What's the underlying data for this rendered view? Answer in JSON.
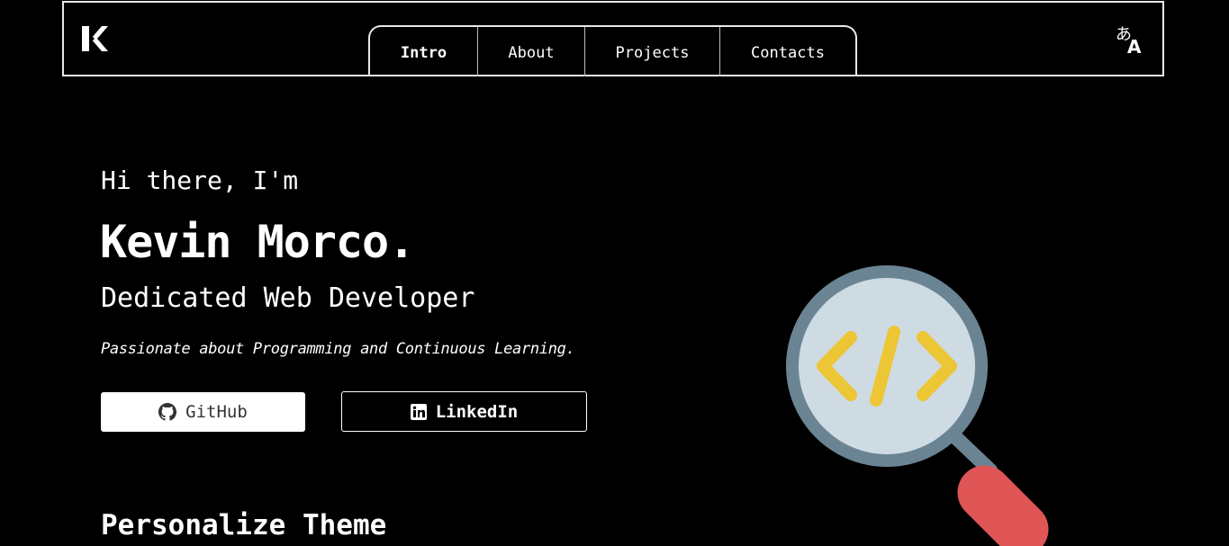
{
  "header": {
    "logo_alt": "K",
    "nav": [
      {
        "label": "Intro",
        "active": true
      },
      {
        "label": "About",
        "active": false
      },
      {
        "label": "Projects",
        "active": false
      },
      {
        "label": "Contacts",
        "active": false
      }
    ],
    "language_icon": "translate-icon"
  },
  "hero": {
    "greeting": "Hi there, I'm",
    "name": "Kevin Morco.",
    "role": "Dedicated Web Developer",
    "tagline": "Passionate about Programming and Continuous Learning.",
    "buttons": {
      "github_label": "GitHub",
      "github_icon": "github-icon",
      "linkedin_label": "LinkedIn",
      "linkedin_icon": "linkedin-icon"
    },
    "illustration_icon": "magnifying-glass-code-icon"
  },
  "sections": {
    "theme_title": "Personalize Theme"
  },
  "colors": {
    "background": "#000000",
    "text": "#ffffff",
    "lens_frame": "#6b8494",
    "lens_glass": "#cfdbe3",
    "code_symbol": "#ecc634",
    "handle": "#e05555"
  }
}
